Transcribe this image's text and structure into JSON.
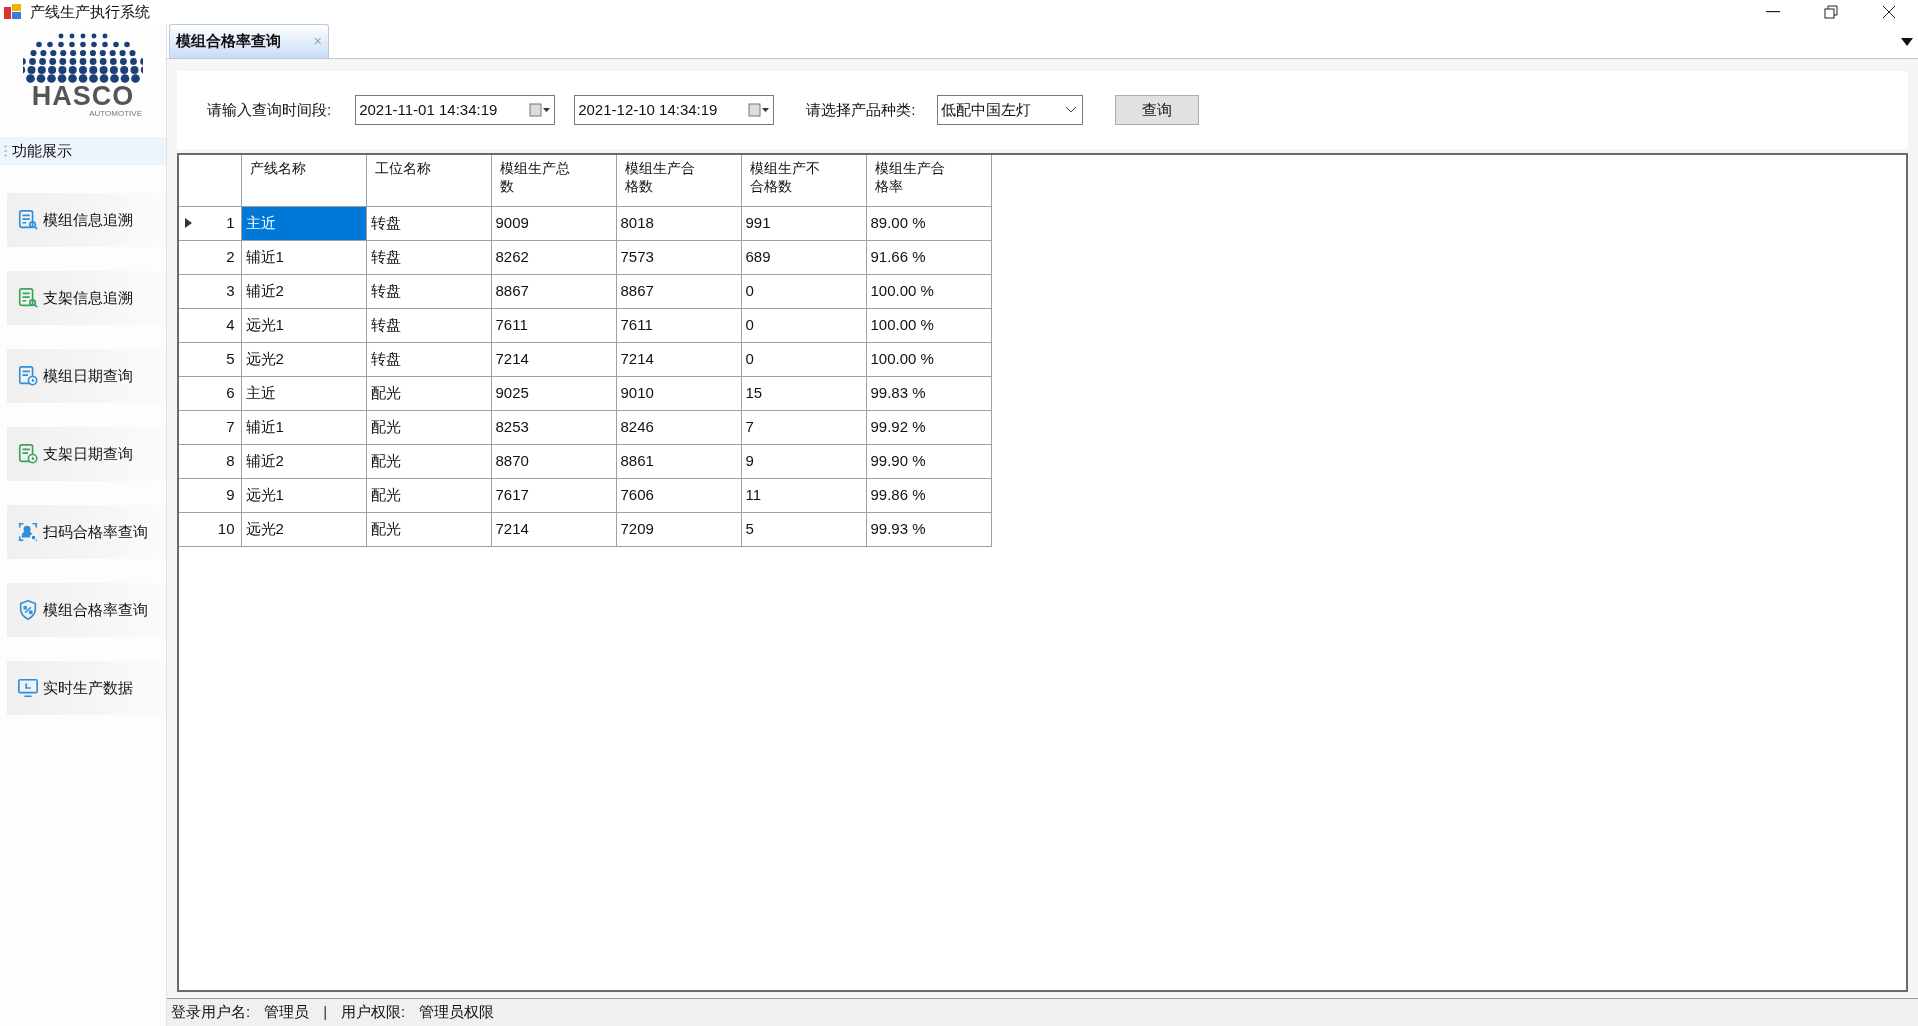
{
  "window": {
    "title": "产线生产执行系统"
  },
  "logo": {
    "name": "HASCO",
    "tagline": "AUTOMOTIVE"
  },
  "sidebar": {
    "header": "功能展示",
    "items": [
      {
        "label": "模组信息追溯",
        "color": "#2f8fd8"
      },
      {
        "label": "支架信息追溯",
        "color": "#3aa55a"
      },
      {
        "label": "模组日期查询",
        "color": "#2f8fd8"
      },
      {
        "label": "支架日期查询",
        "color": "#3aa55a"
      },
      {
        "label": "扫码合格率查询",
        "color": "#2f8fd8"
      },
      {
        "label": "模组合格率查询",
        "color": "#2f8fd8"
      },
      {
        "label": "实时生产数据",
        "color": "#2f8fd8"
      }
    ]
  },
  "tabs": [
    {
      "label": "模组合格率查询",
      "selected": true,
      "close": "×"
    }
  ],
  "query": {
    "time_label": "请输入查询时间段:",
    "start": "2021-11-01 14:34:19",
    "end": "2021-12-10 14:34:19",
    "product_label": "请选择产品种类:",
    "product": "低配中国左灯",
    "button": "查询"
  },
  "table": {
    "columns": [
      "产线名称",
      "工位名称",
      "模组生产总数",
      "模组生产合格数",
      "模组生产不合格数",
      "模组生产合格率"
    ],
    "rows": [
      {
        "index": "1",
        "current": true,
        "cells": [
          {
            "text": "主近",
            "selected": true
          },
          {
            "text": "转盘",
            "selected": false
          },
          {
            "text": "9009",
            "selected": false
          },
          {
            "text": "8018",
            "selected": false
          },
          {
            "text": "991",
            "selected": false
          },
          {
            "text": "89.00 %",
            "selected": false
          }
        ]
      },
      {
        "index": "2",
        "current": false,
        "cells": [
          {
            "text": "辅近1",
            "selected": false
          },
          {
            "text": "转盘",
            "selected": false
          },
          {
            "text": "8262",
            "selected": false
          },
          {
            "text": "7573",
            "selected": false
          },
          {
            "text": "689",
            "selected": false
          },
          {
            "text": "91.66 %",
            "selected": false
          }
        ]
      },
      {
        "index": "3",
        "current": false,
        "cells": [
          {
            "text": "辅近2",
            "selected": false
          },
          {
            "text": "转盘",
            "selected": false
          },
          {
            "text": "8867",
            "selected": false
          },
          {
            "text": "8867",
            "selected": false
          },
          {
            "text": "0",
            "selected": false
          },
          {
            "text": "100.00 %",
            "selected": false
          }
        ]
      },
      {
        "index": "4",
        "current": false,
        "cells": [
          {
            "text": "远光1",
            "selected": false
          },
          {
            "text": "转盘",
            "selected": false
          },
          {
            "text": "7611",
            "selected": false
          },
          {
            "text": "7611",
            "selected": false
          },
          {
            "text": "0",
            "selected": false
          },
          {
            "text": "100.00 %",
            "selected": false
          }
        ]
      },
      {
        "index": "5",
        "current": false,
        "cells": [
          {
            "text": "远光2",
            "selected": false
          },
          {
            "text": "转盘",
            "selected": false
          },
          {
            "text": "7214",
            "selected": false
          },
          {
            "text": "7214",
            "selected": false
          },
          {
            "text": "0",
            "selected": false
          },
          {
            "text": "100.00 %",
            "selected": false
          }
        ]
      },
      {
        "index": "6",
        "current": false,
        "cells": [
          {
            "text": "主近",
            "selected": false
          },
          {
            "text": "配光",
            "selected": false
          },
          {
            "text": "9025",
            "selected": false
          },
          {
            "text": "9010",
            "selected": false
          },
          {
            "text": "15",
            "selected": false
          },
          {
            "text": "99.83 %",
            "selected": false
          }
        ]
      },
      {
        "index": "7",
        "current": false,
        "cells": [
          {
            "text": "辅近1",
            "selected": false
          },
          {
            "text": "配光",
            "selected": false
          },
          {
            "text": "8253",
            "selected": false
          },
          {
            "text": "8246",
            "selected": false
          },
          {
            "text": "7",
            "selected": false
          },
          {
            "text": "99.92 %",
            "selected": false
          }
        ]
      },
      {
        "index": "8",
        "current": false,
        "cells": [
          {
            "text": "辅近2",
            "selected": false
          },
          {
            "text": "配光",
            "selected": false
          },
          {
            "text": "8870",
            "selected": false
          },
          {
            "text": "8861",
            "selected": false
          },
          {
            "text": "9",
            "selected": false
          },
          {
            "text": "99.90 %",
            "selected": false
          }
        ]
      },
      {
        "index": "9",
        "current": false,
        "cells": [
          {
            "text": "远光1",
            "selected": false
          },
          {
            "text": "配光",
            "selected": false
          },
          {
            "text": "7617",
            "selected": false
          },
          {
            "text": "7606",
            "selected": false
          },
          {
            "text": "11",
            "selected": false
          },
          {
            "text": "99.86 %",
            "selected": false
          }
        ]
      },
      {
        "index": "10",
        "current": false,
        "cells": [
          {
            "text": "远光2",
            "selected": false
          },
          {
            "text": "配光",
            "selected": false
          },
          {
            "text": "7214",
            "selected": false
          },
          {
            "text": "7209",
            "selected": false
          },
          {
            "text": "5",
            "selected": false
          },
          {
            "text": "99.93 %",
            "selected": false
          }
        ]
      }
    ]
  },
  "status_bar": {
    "user_label": "登录用户名:",
    "user": "管理员",
    "separator": "|",
    "role_label": "用户权限:",
    "role": "管理员权限"
  }
}
